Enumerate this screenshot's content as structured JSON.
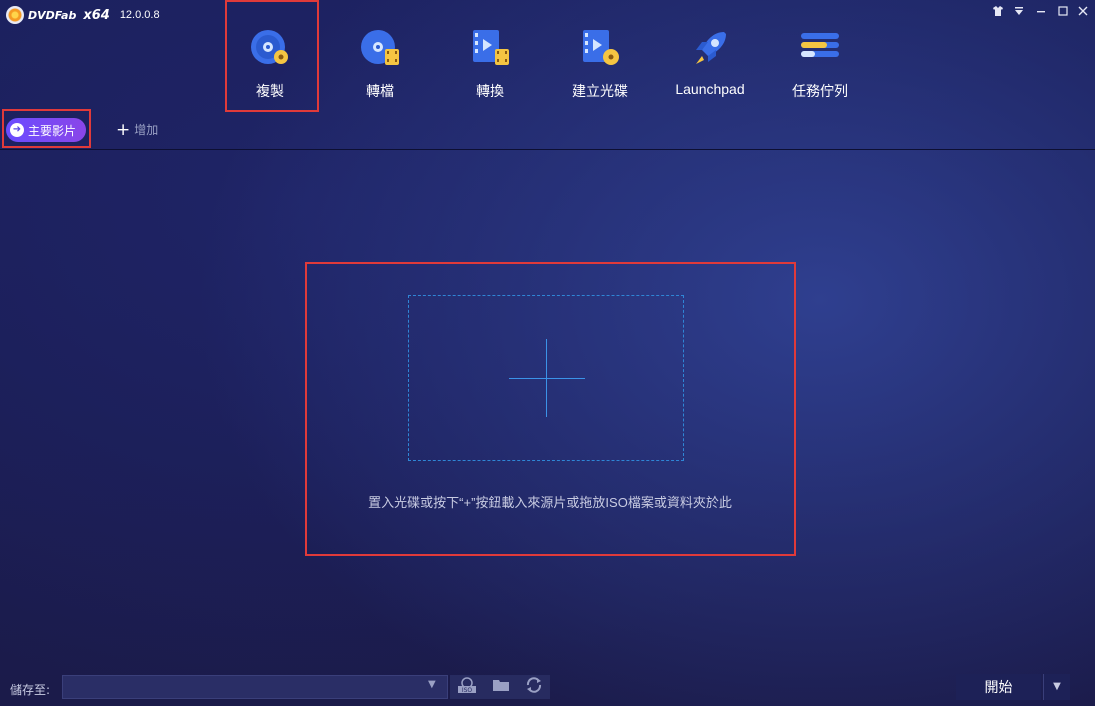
{
  "app": {
    "brand": "DVDFab",
    "arch": "x64",
    "version": "12.0.0.8"
  },
  "window_controls": [
    "skin-icon",
    "menu-icon",
    "minimize-icon",
    "maximize-icon",
    "close-icon"
  ],
  "modules": [
    {
      "label": "複製",
      "icon": "copy-disc-icon",
      "selected": true
    },
    {
      "label": "轉檔",
      "icon": "ripper-icon",
      "selected": false
    },
    {
      "label": "轉換",
      "icon": "converter-icon",
      "selected": false
    },
    {
      "label": "建立光碟",
      "icon": "creator-icon",
      "selected": false
    },
    {
      "label": "Launchpad",
      "icon": "rocket-icon",
      "selected": false
    },
    {
      "label": "任務佇列",
      "icon": "task-queue-icon",
      "selected": false
    }
  ],
  "subbar": {
    "main_movie": "主要影片",
    "add": "增加"
  },
  "dropzone": {
    "hint": "置入光碟或按下“+”按鈕載入來源片或拖放ISO檔案或資料夾於此"
  },
  "bottom": {
    "save_to": "儲存至:",
    "save_path": "",
    "start": "開始"
  },
  "colors": {
    "accent": "#3b93e8",
    "highlight": "#e03a3a",
    "pill": "#7a48f0"
  }
}
